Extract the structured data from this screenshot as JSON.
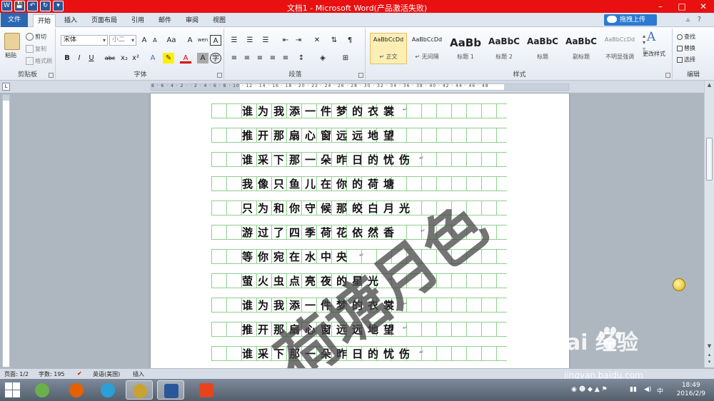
{
  "window": {
    "title": "文档1 - Microsoft Word(产品激活失败)",
    "controls": [
      "–",
      "□",
      "✕"
    ]
  },
  "qat": [
    "W",
    "💾",
    "↶",
    "↻",
    "▾"
  ],
  "tabs": [
    {
      "label": "文件"
    },
    {
      "label": "开始"
    },
    {
      "label": "插入"
    },
    {
      "label": "页面布局"
    },
    {
      "label": "引用"
    },
    {
      "label": "邮件"
    },
    {
      "label": "审阅"
    },
    {
      "label": "视图"
    }
  ],
  "upload_button": "拖拽上传",
  "ribbon": {
    "clipboard": {
      "label": "剪贴板",
      "paste": "粘贴",
      "cut": "剪切",
      "copy": "复制",
      "format_painter": "格式刷"
    },
    "font": {
      "label": "字体",
      "font_name": "宋体",
      "font_size": "小二",
      "bold": "B",
      "italic": "I",
      "underline": "U",
      "strike": "abc",
      "sub": "x₂",
      "sup": "x²",
      "grow": "A",
      "shrink": "A",
      "case": "Aa",
      "clear": "A",
      "wen": "wen",
      "phonetic": "A"
    },
    "paragraph": {
      "label": "段落"
    },
    "styles": {
      "label": "样式",
      "items": [
        {
          "sample": "AaBbCcDd",
          "name": "↵ 正文"
        },
        {
          "sample": "AaBbCcDd",
          "name": "↵ 无间隔"
        },
        {
          "sample": "AaBb",
          "name": "标题 1"
        },
        {
          "sample": "AaBbC",
          "name": "标题 2"
        },
        {
          "sample": "AaBbC",
          "name": "标题"
        },
        {
          "sample": "AaBbC",
          "name": "副标题"
        },
        {
          "sample": "AaBbCcDd",
          "name": "不明显强调"
        }
      ],
      "change": "更改样式"
    },
    "editing": {
      "label": "编辑",
      "find": "查找",
      "replace": "替换",
      "select": "选择"
    }
  },
  "ruler_numbers": "8 · 6 · 4 · 2 ·  · 2 · 4 · 6 · 8 · 10 · 12 · 14 · 16 · 18 · 20 · 22 · 24 · 26 · 28 · 30 · 32 · 34 · 36 · 38 · 40 · 42 · 44 · 46 · 48",
  "document": {
    "lines": [
      "谁为我添一件梦的衣裳",
      "推开那扇心窗远远地望",
      "谁采下那一朵昨日的忧伤",
      "我像只鱼儿在你的荷塘",
      "只为和你守候那皎白月光",
      "游过了四季荷花依然香",
      "等你宛在水中央",
      "萤火虫点亮夜的星光",
      "谁为我添一件梦的衣裳",
      "推开那扇心窗远远地望",
      "谁采下那一朵昨日的忧伤"
    ],
    "watermark": "荷塘月色",
    "para_mark": "↵"
  },
  "status": {
    "page": "页面: 1/2",
    "words": "字数: 195",
    "lang": "英语(美国)",
    "mode": "插入"
  },
  "taskbar": {
    "apps": [
      {
        "name": "windows-start"
      },
      {
        "name": "360-browser",
        "color": "#6ab04c"
      },
      {
        "name": "firefox",
        "color": "#e66000"
      },
      {
        "name": "qq",
        "color": "#2a9fd8"
      },
      {
        "name": "input-method",
        "color": "#c8a233"
      },
      {
        "name": "word",
        "color": "#2b579a"
      },
      {
        "name": "sogou",
        "color": "#e8431f"
      }
    ],
    "time": "18:49",
    "date": "2016/2/9",
    "ime": "中"
  },
  "overlay": {
    "baidu_text": "Bai 经验",
    "baidu_url": "jingyan.baidu.com"
  }
}
